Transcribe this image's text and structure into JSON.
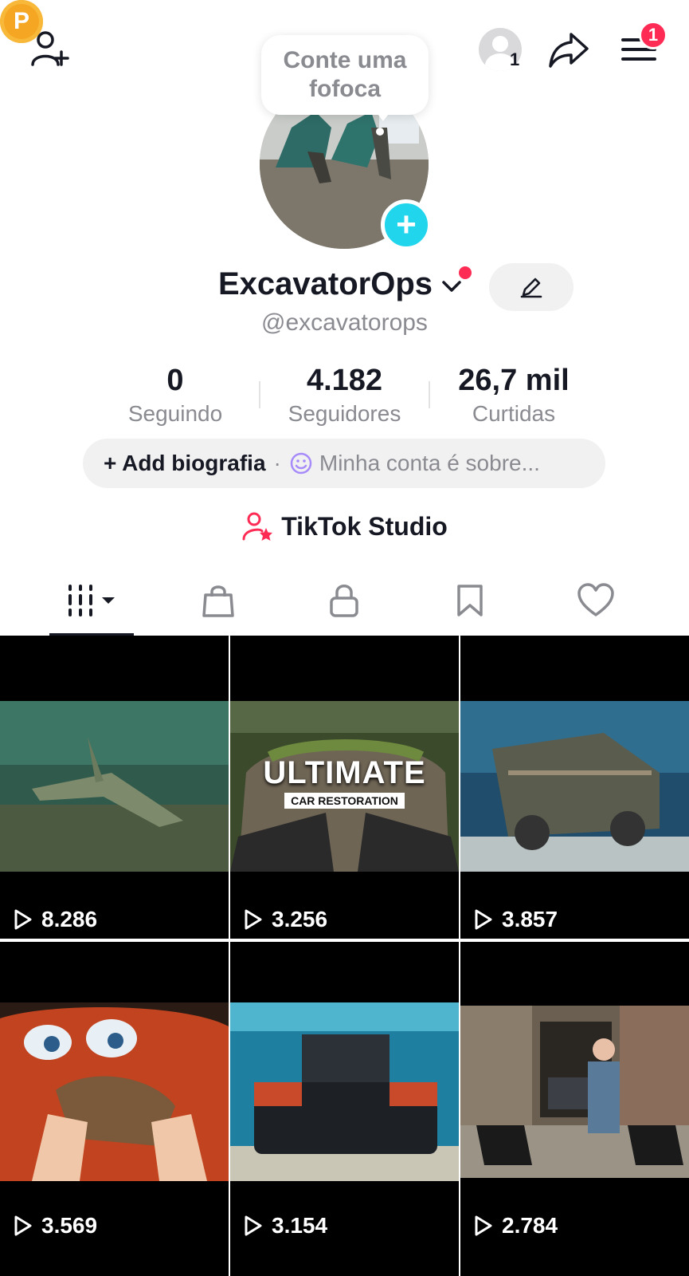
{
  "topbar": {
    "add_friend_icon": "person-plus-icon",
    "coin_label": "P",
    "account_count": "1",
    "share_icon": "share-arrow-icon",
    "menu_icon": "hamburger-icon",
    "notification_count": "1"
  },
  "profile": {
    "bubble_text": "Conte uma fofoca",
    "username": "ExcavatorOps",
    "handle": "@excavatorops"
  },
  "stats": [
    {
      "value": "0",
      "label": "Seguindo"
    },
    {
      "value": "4.182",
      "label": "Seguidores"
    },
    {
      "value": "26,7 mil",
      "label": "Curtidas"
    }
  ],
  "bio": {
    "add_label": "+ Add biografia",
    "separator": "·",
    "hint": "Minha conta é sobre..."
  },
  "studio": {
    "label": "TikTok Studio"
  },
  "tabs": [
    {
      "name": "videos",
      "icon": "grid-bars-icon"
    },
    {
      "name": "shop",
      "icon": "shopping-bag-icon"
    },
    {
      "name": "private",
      "icon": "lock-icon"
    },
    {
      "name": "saved",
      "icon": "bookmark-icon"
    },
    {
      "name": "liked",
      "icon": "heart-icon"
    }
  ],
  "videos": [
    {
      "views": "8.286",
      "scene": "sunken airplane underwater"
    },
    {
      "views": "3.256",
      "scene": "mossy car in forest",
      "title": "ULTIMATE",
      "subtitle": "CAR RESTORATION"
    },
    {
      "views": "3.857",
      "scene": "coral covered truck underwater"
    },
    {
      "views": "3.569",
      "scene": "rusty cartoon car with hands"
    },
    {
      "views": "3.154",
      "scene": "truck underwater"
    },
    {
      "views": "2.784",
      "scene": "barn with jeep and person"
    }
  ],
  "colors": {
    "accent": "#fe2c55",
    "cyan": "#20d5ec",
    "coin": "#f5a623",
    "muted": "#8a8b91"
  }
}
